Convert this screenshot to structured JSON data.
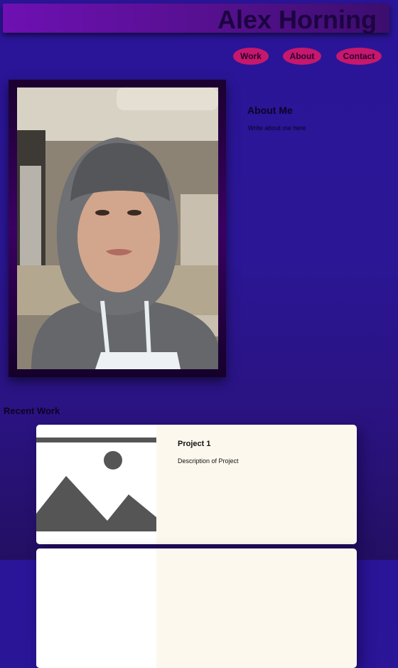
{
  "header": {
    "title": "Alex Horning"
  },
  "nav": {
    "items": [
      {
        "label": "Work"
      },
      {
        "label": "About"
      },
      {
        "label": "Contact"
      }
    ]
  },
  "about": {
    "title": "About Me",
    "text": "Write about me here"
  },
  "recent": {
    "title": "Recent Work",
    "projects": [
      {
        "title": "Project 1",
        "description": "Description of Project"
      }
    ]
  },
  "colors": {
    "header_gradient_start": "#6e10b3",
    "nav_button": "#c6186c",
    "page_background": "#2a1598",
    "card_background": "#fdf8ee"
  },
  "icons": {
    "profile_photo": "profile-photo",
    "placeholder": "image-placeholder-icon"
  }
}
